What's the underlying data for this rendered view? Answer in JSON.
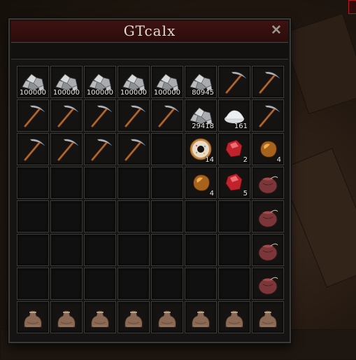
{
  "window": {
    "title": "GTcalx",
    "close_label": "✕"
  },
  "inventory": {
    "rows": [
      [
        {
          "icon": "ore",
          "count": "100000"
        },
        {
          "icon": "ore",
          "count": "100000"
        },
        {
          "icon": "ore",
          "count": "100000"
        },
        {
          "icon": "ore",
          "count": "100000"
        },
        {
          "icon": "ore",
          "count": "100000"
        },
        {
          "icon": "ore",
          "count": "80945"
        },
        {
          "icon": "pickaxe",
          "count": ""
        },
        {
          "icon": "pickaxe",
          "count": ""
        }
      ],
      [
        {
          "icon": "pickaxe",
          "count": ""
        },
        {
          "icon": "pickaxe",
          "count": ""
        },
        {
          "icon": "pickaxe",
          "count": ""
        },
        {
          "icon": "pickaxe",
          "count": ""
        },
        {
          "icon": "pickaxe",
          "count": ""
        },
        {
          "icon": "ore",
          "count": "29418"
        },
        {
          "icon": "salt",
          "count": "161"
        },
        {
          "icon": "pickaxe",
          "count": ""
        }
      ],
      [
        {
          "icon": "pickaxe",
          "count": ""
        },
        {
          "icon": "pickaxe",
          "count": ""
        },
        {
          "icon": "pickaxe",
          "count": ""
        },
        {
          "icon": "pickaxe",
          "count": ""
        },
        {
          "icon": "empty",
          "count": ""
        },
        {
          "icon": "donut",
          "count": "14"
        },
        {
          "icon": "ruby",
          "count": "2"
        },
        {
          "icon": "amber",
          "count": "4"
        }
      ],
      [
        {
          "icon": "empty",
          "count": ""
        },
        {
          "icon": "empty",
          "count": ""
        },
        {
          "icon": "empty",
          "count": ""
        },
        {
          "icon": "empty",
          "count": ""
        },
        {
          "icon": "empty",
          "count": ""
        },
        {
          "icon": "amber",
          "count": "4"
        },
        {
          "icon": "ruby",
          "count": "5"
        },
        {
          "icon": "pouch",
          "count": ""
        }
      ],
      [
        {
          "icon": "empty",
          "count": ""
        },
        {
          "icon": "empty",
          "count": ""
        },
        {
          "icon": "empty",
          "count": ""
        },
        {
          "icon": "empty",
          "count": ""
        },
        {
          "icon": "empty",
          "count": ""
        },
        {
          "icon": "empty",
          "count": ""
        },
        {
          "icon": "empty",
          "count": ""
        },
        {
          "icon": "pouch",
          "count": ""
        }
      ],
      [
        {
          "icon": "empty",
          "count": ""
        },
        {
          "icon": "empty",
          "count": ""
        },
        {
          "icon": "empty",
          "count": ""
        },
        {
          "icon": "empty",
          "count": ""
        },
        {
          "icon": "empty",
          "count": ""
        },
        {
          "icon": "empty",
          "count": ""
        },
        {
          "icon": "empty",
          "count": ""
        },
        {
          "icon": "pouch",
          "count": ""
        }
      ],
      [
        {
          "icon": "empty",
          "count": ""
        },
        {
          "icon": "empty",
          "count": ""
        },
        {
          "icon": "empty",
          "count": ""
        },
        {
          "icon": "empty",
          "count": ""
        },
        {
          "icon": "empty",
          "count": ""
        },
        {
          "icon": "empty",
          "count": ""
        },
        {
          "icon": "empty",
          "count": ""
        },
        {
          "icon": "pouch",
          "count": ""
        }
      ],
      [
        {
          "icon": "sack",
          "count": ""
        },
        {
          "icon": "sack",
          "count": ""
        },
        {
          "icon": "sack",
          "count": ""
        },
        {
          "icon": "sack",
          "count": ""
        },
        {
          "icon": "sack",
          "count": ""
        },
        {
          "icon": "sack",
          "count": ""
        },
        {
          "icon": "sack",
          "count": ""
        },
        {
          "icon": "sack",
          "count": ""
        }
      ]
    ]
  }
}
